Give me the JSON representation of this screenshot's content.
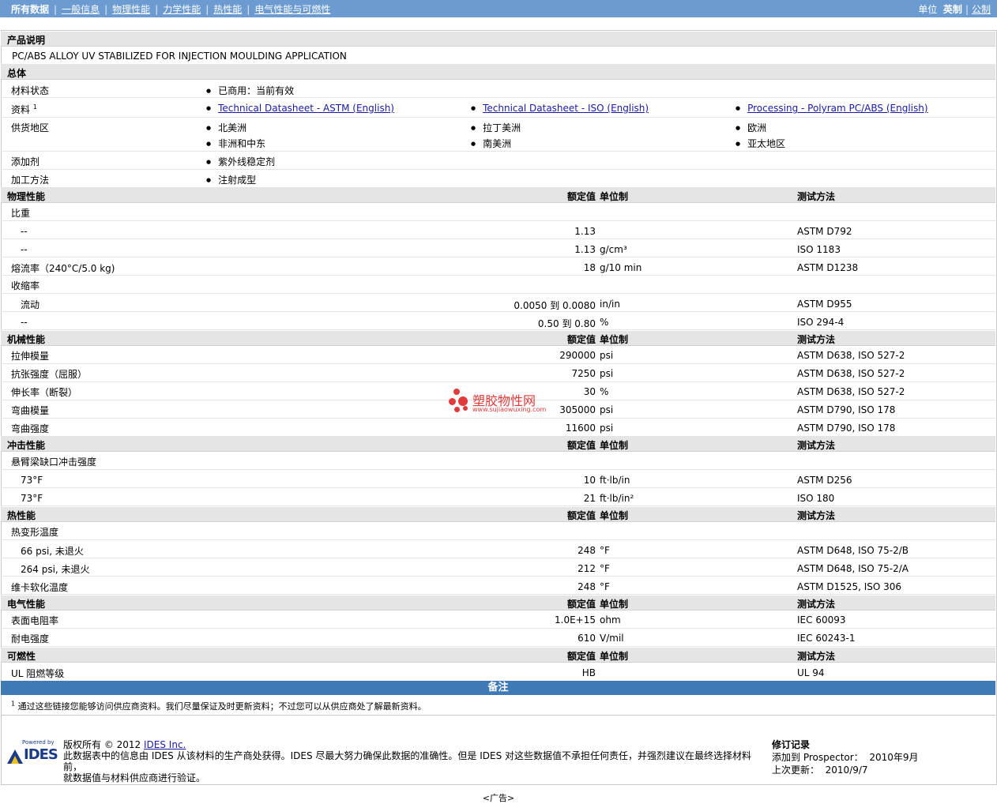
{
  "nav": {
    "items": [
      "所有数据",
      "一般信息",
      "物理性能",
      "力学性能",
      "热性能",
      "电气性能与可燃性"
    ],
    "unit_label": "单位",
    "unit_english": "英制",
    "unit_metric": "公制"
  },
  "product": {
    "header": "产品说明",
    "description": "PC/ABS ALLOY UV STABILIZED FOR INJECTION MOULDING APPLICATION"
  },
  "general": {
    "header": "总体",
    "material_status_label": "材料状态",
    "material_status": "已商用：当前有效",
    "resources_label": "资料",
    "resources_sup": "1",
    "resources": [
      "Technical Datasheet - ASTM (English)",
      "Technical Datasheet - ISO (English)",
      "Processing - Polyram PC/ABS (English)"
    ],
    "supply_label": "供货地区",
    "supply": [
      "北美洲",
      "拉丁美洲",
      "欧洲",
      "非洲和中东",
      "南美洲",
      "亚太地区"
    ],
    "additive_label": "添加剂",
    "additive": "紫外线稳定剂",
    "process_label": "加工方法",
    "process": "注射成型"
  },
  "columns": {
    "value": "额定值",
    "unit": "单位制",
    "method": "测试方法"
  },
  "physical": {
    "header": "物理性能",
    "sg_label": "比重",
    "rows": [
      {
        "label": "--",
        "value": "1.13",
        "unit": "",
        "method": "ASTM D792"
      },
      {
        "label": "--",
        "value": "1.13",
        "unit": "g/cm³",
        "method": "ISO 1183"
      }
    ],
    "mfr": {
      "label": "熔流率（240°C/5.0 kg)",
      "value": "18",
      "unit": "g/10 min",
      "method": "ASTM D1238"
    },
    "shrink_label": "收缩率",
    "shrink": [
      {
        "label": "流动",
        "value": "0.0050 到  0.0080",
        "unit": "in/in",
        "method": "ASTM D955"
      },
      {
        "label": "--",
        "value": "0.50 到  0.80",
        "unit": "%",
        "method": "ISO 294-4"
      }
    ]
  },
  "mechanical": {
    "header": "机械性能",
    "rows": [
      {
        "label": "拉伸模量",
        "value": "290000",
        "unit": "psi",
        "method": "ASTM D638, ISO 527-2"
      },
      {
        "label": "抗张强度（屈服）",
        "value": "7250",
        "unit": "psi",
        "method": "ASTM D638, ISO 527-2"
      },
      {
        "label": "伸长率（断裂）",
        "value": "30",
        "unit": "%",
        "method": "ASTM D638, ISO 527-2"
      },
      {
        "label": "弯曲模量",
        "value": "305000",
        "unit": "psi",
        "method": "ASTM D790, ISO 178"
      },
      {
        "label": "弯曲强度",
        "value": "11600",
        "unit": "psi",
        "method": "ASTM D790, ISO 178"
      }
    ]
  },
  "impact": {
    "header": "冲击性能",
    "sub_label": "悬臂梁缺口冲击强度",
    "rows": [
      {
        "label": "73°F",
        "value": "10",
        "unit": "ft·lb/in",
        "method": "ASTM D256"
      },
      {
        "label": "73°F",
        "value": "21",
        "unit": "ft·lb/in²",
        "method": "ISO 180"
      }
    ]
  },
  "thermal": {
    "header": "热性能",
    "sub_label": "热变形温度",
    "rows": [
      {
        "label": "66 psi, 未退火",
        "value": "248",
        "unit": "°F",
        "method": "ASTM D648, ISO 75-2/B"
      },
      {
        "label": "264 psi, 未退火",
        "value": "212",
        "unit": "°F",
        "method": "ASTM D648, ISO 75-2/A"
      }
    ],
    "vicat": {
      "label": "维卡软化温度",
      "value": "248",
      "unit": "°F",
      "method": "ASTM D1525, ISO 306"
    }
  },
  "electrical": {
    "header": "电气性能",
    "rows": [
      {
        "label": "表面电阻率",
        "value": "1.0E+15",
        "unit": "ohm",
        "method": "IEC 60093"
      },
      {
        "label": "耐电强度",
        "value": "610",
        "unit": "V/mil",
        "method": "IEC 60243-1"
      }
    ]
  },
  "flammability": {
    "header": "可燃性",
    "row": {
      "label": "UL 阻燃等级",
      "value": "HB",
      "unit": "",
      "method": "UL 94"
    }
  },
  "notes": {
    "header": "备注",
    "sup": "1",
    "text": "通过这些链接您能够访问供应商资料。我们尽量保证及时更新资料；不过您可以从供应商处了解最新资料。"
  },
  "watermark": {
    "text": "塑胶物性网",
    "url": "www.sujiaowuxing.com"
  },
  "footer": {
    "powered_by": "Powered by",
    "logo_text": "IDES",
    "copyright_prefix": "版权所有 © 2012",
    "ides_link": "IDES Inc.",
    "line1": "此数据表中的信息由 IDES 从该材料的生产商处获得。IDES 尽最大努力确保此数据的准确性。但是 IDES 对这些数据值不承担任何责任，并强烈建议在最终选择材料前，",
    "line2": "就数据值与材料供应商进行验证。",
    "revision_title": "修订记录",
    "added_label": "添加到 Prospector：",
    "added_date": "2010年9月",
    "updated_label": "上次更新：",
    "updated_date": "2010/9/7"
  },
  "ad": "<广告>"
}
